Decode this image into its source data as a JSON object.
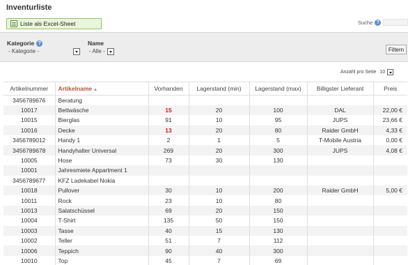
{
  "page_title": "Inventurliste",
  "excel_button": "Liste als Excel-Sheet",
  "search_label": "Suche",
  "filters": {
    "kategorie_label": "Kategorie",
    "kategorie_value": "- Kategorie -",
    "name_label": "Name",
    "name_value": "- Alle -",
    "filter_button": "Filtern"
  },
  "per_page_label": "Anzahl pro Seite",
  "per_page_value": "10",
  "table": {
    "headers": [
      "Artikelnummer",
      "Artikelname",
      "Vorhanden",
      "Lagerstand (min)",
      "Lagerstand (max)",
      "Billigster Lieferant",
      "Preis"
    ],
    "sort_arrow": "▲",
    "rows": [
      [
        "3456789676",
        "Beratung",
        "",
        "",
        "",
        "",
        ""
      ],
      [
        "10017",
        "Bettwäsche",
        "15",
        "20",
        "100",
        "DAL",
        "22,00 €"
      ],
      [
        "10015",
        "Bierglas",
        "91",
        "10",
        "95",
        "JUPS",
        "23,66 €"
      ],
      [
        "10016",
        "Decke",
        "13",
        "20",
        "80",
        "Raider GmbH",
        "4,33 €"
      ],
      [
        "3456789012",
        "Handy 1",
        "2",
        "1",
        "5",
        "T-Mobile Austria",
        "0,00 €"
      ],
      [
        "3456789678",
        "Handyhalter Universal",
        "269",
        "20",
        "300",
        "JUPS",
        "4,08 €"
      ],
      [
        "10005",
        "Hose",
        "73",
        "30",
        "130",
        "",
        ""
      ],
      [
        "10001",
        "Jahresmiete Appartment 1",
        "",
        "",
        "",
        "",
        ""
      ],
      [
        "3456789677",
        "KFZ Ladekabel Nokia",
        "",
        "",
        "",
        "",
        ""
      ],
      [
        "10018",
        "Pullover",
        "30",
        "10",
        "200",
        "Raider GmbH",
        "5,00 €"
      ],
      [
        "10011",
        "Rock",
        "23",
        "10",
        "80",
        "",
        ""
      ],
      [
        "10013",
        "Salatschüssel",
        "69",
        "20",
        "150",
        "",
        ""
      ],
      [
        "10004",
        "T-Shirt",
        "135",
        "50",
        "150",
        "",
        ""
      ],
      [
        "10003",
        "Tasse",
        "40",
        "15",
        "130",
        "",
        ""
      ],
      [
        "10002",
        "Teller",
        "51",
        "7",
        "112",
        "",
        ""
      ],
      [
        "10006",
        "Teppich",
        "90",
        "40",
        "300",
        "",
        ""
      ],
      [
        "10010",
        "Top",
        "45",
        "7",
        "69",
        "",
        ""
      ]
    ],
    "low_stock_rows": [
      1,
      3
    ]
  },
  "colors": {
    "header_sorted": "#c0502a",
    "low_stock": "#cc1b1b",
    "excel_button_bg": "#e9f6d9",
    "help_icon": "#5b8fd4"
  },
  "icons": {
    "excel_button": "excel-sheet-icon",
    "help": "help-icon",
    "dropdown": "chevron-down-icon"
  }
}
